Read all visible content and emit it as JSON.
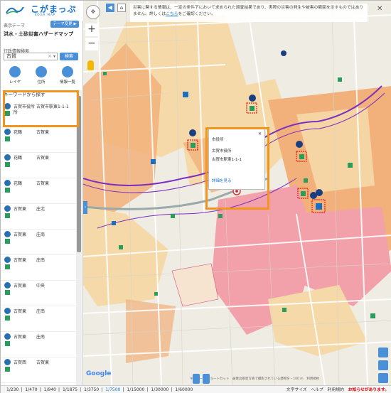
{
  "app": {
    "title": "こがまっぷ",
    "subtitle": "KOGA MAP"
  },
  "sidebar": {
    "theme_label": "表示テーマ",
    "theme_change": "テーマ変更 ▶",
    "theme_name": "洪水・土砂災害ハザードマップ",
    "search_label": "行政情報検索",
    "search_value": "古賀",
    "search_button": "検索",
    "tools": [
      {
        "label": "レイヤ"
      },
      {
        "label": "住所"
      },
      {
        "label": "情報一覧"
      }
    ],
    "keyword_header": "キーワードから探す",
    "results": [
      {
        "c1": "古賀市役所",
        "c2": "古賀市駅東1-1-1",
        "c1b": "所"
      },
      {
        "c1": "花鶴",
        "c2": "古賀東",
        "c1b": ""
      },
      {
        "c1": "花鶴",
        "c2": "古賀東",
        "c1b": ""
      },
      {
        "c1": "花鶴",
        "c2": "古賀東",
        "c1b": ""
      },
      {
        "c1": "古賀東",
        "c2": "庄北",
        "c1b": ""
      },
      {
        "c1": "古賀東",
        "c2": "庄南",
        "c1b": ""
      },
      {
        "c1": "古賀東",
        "c2": "庄南",
        "c1b": ""
      },
      {
        "c1": "古賀東",
        "c2": "中央",
        "c1b": ""
      },
      {
        "c1": "古賀東",
        "c2": "庄南",
        "c1b": ""
      },
      {
        "c1": "古賀東",
        "c2": "庄南",
        "c1b": ""
      },
      {
        "c1": "古賀西",
        "c2": "古賀東",
        "c1b": ""
      }
    ]
  },
  "map": {
    "notice_text": "災害に関する情報は、一定の条件下において求められた調査結果であり、実際の災害の発生や被害の範囲を示すものではありません。詳しくは",
    "notice_link": "こちら",
    "notice_tail": "をご確認ください。",
    "popup": {
      "title": "市役所",
      "line1": "古賀市役所",
      "line2": "古賀市駅東1-1-1",
      "detail": "詳細を見る"
    },
    "google": "Google",
    "footer": "キーボード ショートカット　画像は衛星写真で撮影されている建物を・100 m　利用規約"
  },
  "scale": {
    "items": [
      "1/230",
      "1/470",
      "1/940",
      "1/1875",
      "1/3750",
      "1/7500",
      "1/15000",
      "1/30000",
      "1/60000"
    ],
    "active_index": 5
  },
  "bottom_links": {
    "text_size": "文字サイズ",
    "help": "ヘルプ",
    "terms": "利用規約",
    "alert": "お知らせがあります。"
  },
  "colors": {
    "flood_light": "#f6d9a8",
    "flood_orange": "#f2b07a",
    "flood_pink": "#f2a0aa",
    "river": "#7b2fc0",
    "road": "#ffffff",
    "accent": "#4a90d9",
    "highlight": "#f0961e"
  }
}
